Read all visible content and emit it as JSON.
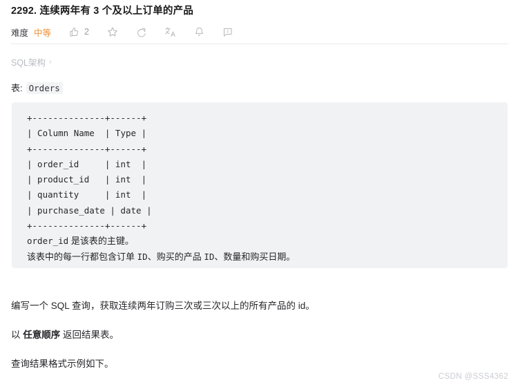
{
  "problem": {
    "title": "2292. 连续两年有 3 个及以上订单的产品"
  },
  "meta": {
    "difficulty_label": "难度",
    "difficulty_value": "中等",
    "difficulty_color": "#ef8f33",
    "tools": [
      {
        "icon": "thumbs-up-icon",
        "count": "2"
      },
      {
        "icon": "star-icon",
        "count": ""
      },
      {
        "icon": "refresh-icon",
        "count": ""
      },
      {
        "icon": "translate-icon",
        "count": ""
      },
      {
        "icon": "bell-icon",
        "count": ""
      },
      {
        "icon": "comment-icon",
        "count": ""
      }
    ]
  },
  "breadcrumb": {
    "label": "SQL架构",
    "chevron": "›"
  },
  "table_section": {
    "caption_prefix": "表:",
    "caption_table": "Orders",
    "ascii_table": "+--------------+------+\n| Column Name  | Type |\n+--------------+------+\n| order_id     | int  |\n| product_id   | int  |\n| quantity     | int  |\n| purchase_date | date |\n+--------------+------+",
    "ascii_lines": [
      "+--------------+------+",
      "| Column Name  | Type |",
      "+--------------+------+",
      "| order_id     | int  |",
      "| product_id   | int  |",
      "| quantity     | int  |",
      "| purchase_date | date |",
      "+--------------+------+"
    ],
    "note_line_1_code": "order_id",
    "note_line_1_text": " 是该表的主键。",
    "note_line_2_a": "该表中的每一行都包含订单 ",
    "note_line_2_id1": "ID",
    "note_line_2_b": "、购买的产品 ",
    "note_line_2_id2": "ID",
    "note_line_2_c": "、数量和购买日期。"
  },
  "columns": {
    "headers": [
      "Column Name",
      "Type"
    ],
    "rows": [
      [
        "order_id",
        "int"
      ],
      [
        "product_id",
        "int"
      ],
      [
        "quantity",
        "int"
      ],
      [
        "purchase_date",
        "date"
      ]
    ]
  },
  "body": {
    "paragraph_1": "编写一个 SQL 查询，获取连续两年订购三次或三次以上的所有产品的 id。",
    "paragraph_2_before": "以 ",
    "paragraph_2_bold": "任意顺序",
    "paragraph_2_after": " 返回结果表。",
    "paragraph_3": "查询结果格式示例如下。"
  },
  "watermark": "CSDN @SSS4362"
}
